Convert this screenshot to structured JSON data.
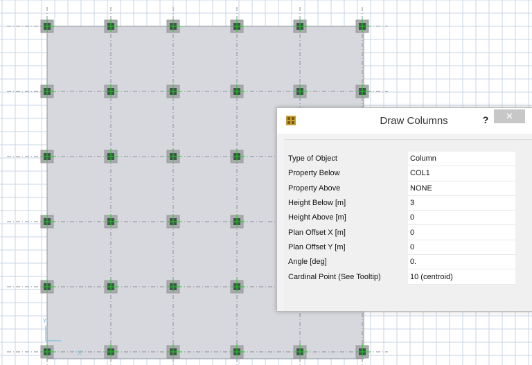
{
  "dialog": {
    "title": "Draw Columns",
    "help_label": "?",
    "close_label": "✕",
    "properties": [
      {
        "label": "Type of Object",
        "value": "Column"
      },
      {
        "label": "Property Below",
        "value": "COL1"
      },
      {
        "label": "Property Above",
        "value": "NONE"
      },
      {
        "label": "Height Below  [m]",
        "value": "3"
      },
      {
        "label": "Height Above  [m]",
        "value": "0"
      },
      {
        "label": "Plan Offset X  [m]",
        "value": "0"
      },
      {
        "label": "Plan Offset Y  [m]",
        "value": "0"
      },
      {
        "label": "Angle  [deg]",
        "value": "0."
      },
      {
        "label": "Cardinal Point  (See Tooltip)",
        "value": "10  (centroid)"
      }
    ]
  },
  "colors": {
    "grid_line": "#c9d6e6",
    "slab_fill": "#d6d8dd",
    "column_fill": "#3a5a45",
    "column_outline": "#9a9a9a",
    "axis_tick": "#22cc22"
  },
  "icons": {
    "app": "etabs-app-icon",
    "axis": "xy-axis-icon"
  }
}
